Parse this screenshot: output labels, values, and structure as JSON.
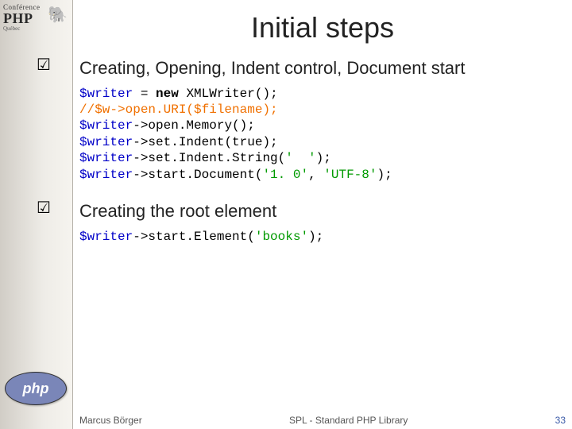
{
  "conference": {
    "small": "Conférence",
    "big": "PHP",
    "loc": "Québec"
  },
  "php_logo_text": "php",
  "title": "Initial steps",
  "checkmark": "☑",
  "bullets": [
    "Creating, Opening, Indent control, Document start",
    "Creating the root element"
  ],
  "code1": {
    "l1_var": "$writer",
    "l1_eq": " = ",
    "l1_kw": "new",
    "l1_rest": " XMLWriter();",
    "l2_cmt": "//$w->open.URI($filename);",
    "l3_var": "$writer",
    "l3_rest": "->open.Memory();",
    "l4_var": "$writer",
    "l4_mid": "->set.Indent(",
    "l4_bool": "true",
    "l4_end": ");",
    "l5_var": "$writer",
    "l5_mid": "->set.Indent.String(",
    "l5_str": "'  '",
    "l5_end": ");",
    "l6_var": "$writer",
    "l6_mid": "->start.Document(",
    "l6_s1": "'1. 0'",
    "l6_comma": ", ",
    "l6_s2": "'UTF-8'",
    "l6_end": ");"
  },
  "code2": {
    "l1_var": "$writer",
    "l1_mid": "->start.Element(",
    "l1_str": "'books'",
    "l1_end": ");"
  },
  "footer": {
    "author": "Marcus Börger",
    "mid": "SPL - Standard PHP Library",
    "page": "33"
  }
}
